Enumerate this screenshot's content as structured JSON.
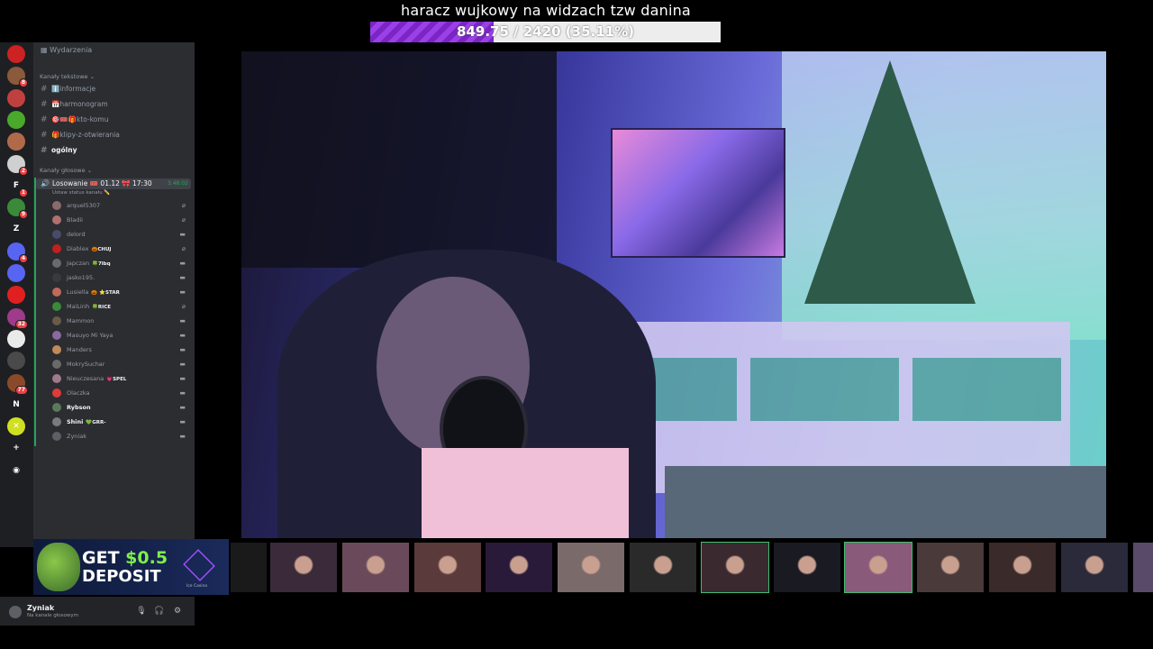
{
  "goal": {
    "title": "haracz wujkowy na widzach tzw danina",
    "progress_text": "849.75 / 2420 (35.11%)",
    "progress_fraction": 0.3511,
    "fill_color": "#8a2fd6"
  },
  "rail": {
    "servers": [
      {
        "icon": "server-icon",
        "letter": "",
        "color": "#c22",
        "badge": ""
      },
      {
        "icon": "server-icon",
        "letter": "",
        "color": "#8a5a3a",
        "badge": "8"
      },
      {
        "icon": "server-icon",
        "letter": "",
        "color": "#c04040",
        "badge": ""
      },
      {
        "icon": "server-icon",
        "letter": "",
        "color": "#4aa82a",
        "badge": ""
      },
      {
        "icon": "server-icon",
        "letter": "",
        "color": "#b06a4a",
        "badge": ""
      },
      {
        "icon": "server-icon",
        "letter": "",
        "color": "#d0d0d0",
        "badge": "2"
      },
      {
        "icon": "server-icon",
        "letter": "F",
        "color": "#1e1f22",
        "badge": "1"
      },
      {
        "icon": "server-icon",
        "letter": "",
        "color": "#3a8a3a",
        "badge": "9"
      },
      {
        "icon": "server-icon",
        "letter": "Z",
        "color": "#1e1f22",
        "badge": ""
      },
      {
        "icon": "server-icon",
        "letter": "",
        "color": "#5865f2",
        "badge": "4"
      },
      {
        "icon": "server-icon",
        "letter": "",
        "color": "#5865f2",
        "badge": ""
      },
      {
        "icon": "server-icon",
        "letter": "",
        "color": "#e02020",
        "badge": ""
      },
      {
        "icon": "server-icon",
        "letter": "",
        "color": "#a03a8a",
        "badge": "32"
      },
      {
        "icon": "server-icon",
        "letter": "",
        "color": "#eaeaea",
        "badge": ""
      },
      {
        "icon": "server-icon",
        "letter": "",
        "color": "#4a4a4a",
        "badge": ""
      },
      {
        "icon": "server-icon",
        "letter": "",
        "color": "#8a4a2a",
        "badge": "77"
      },
      {
        "icon": "server-icon",
        "letter": "N",
        "color": "#1e1f22",
        "badge": ""
      },
      {
        "icon": "server-icon",
        "letter": "✕",
        "color": "#d0e020",
        "badge": ""
      },
      {
        "icon": "add-server-icon",
        "letter": "+",
        "color": "#1e1f22",
        "badge": ""
      },
      {
        "icon": "explore-icon",
        "letter": "◉",
        "color": "#1e1f22",
        "badge": ""
      }
    ]
  },
  "channels": {
    "events_label": "Wydarzenia",
    "text_category": "Kanały tekstowe",
    "text_channels": [
      {
        "label": "ℹ️informacje"
      },
      {
        "label": "📅harmonogram"
      },
      {
        "label": "🎯🎟️🎁kto-komu"
      },
      {
        "label": "🎁klipy-z-otwierania"
      },
      {
        "label": "ogólny"
      }
    ],
    "voice_category": "Kanały głosowe",
    "voice_channel": {
      "name": "Losowanie 🎟️ 01.12 🎀 17:30",
      "timer": "3:48:02",
      "status": "Ustaw status kanału ✏️"
    },
    "members": [
      {
        "name": "arquel5307",
        "tag": "",
        "color": "#8a6a6a",
        "hi": false,
        "icon": "mic-muted-icon"
      },
      {
        "name": "Bladii",
        "tag": "",
        "color": "#b07070",
        "hi": false,
        "icon": "mic-muted-icon"
      },
      {
        "name": "delord",
        "tag": "",
        "color": "#4a4a6a",
        "hi": false,
        "icon": "video-icon"
      },
      {
        "name": "Diablex",
        "tag": "🎃CHUJ",
        "color": "#c02020",
        "hi": false,
        "icon": "mic-muted-icon"
      },
      {
        "name": "Japczan",
        "tag": "🍀7lbq",
        "color": "#6a6a6a",
        "hi": false,
        "icon": "video-icon"
      },
      {
        "name": "jasko195.",
        "tag": "",
        "color": "#3a3a3a",
        "hi": false,
        "icon": "video-icon"
      },
      {
        "name": "Lusiella",
        "tag": "🎃 ⭐STAR",
        "color": "#c06a5a",
        "hi": false,
        "icon": "video-icon"
      },
      {
        "name": "MaiLinh",
        "tag": "🍀RICE",
        "color": "#3a8a3a",
        "hi": false,
        "icon": "mic-muted-icon"
      },
      {
        "name": "Mammon",
        "tag": "",
        "color": "#6a5a4a",
        "hi": false,
        "icon": "video-icon"
      },
      {
        "name": "Masuyo Mi Yaya",
        "tag": "",
        "color": "#8a6aa0",
        "hi": false,
        "icon": "video-icon"
      },
      {
        "name": "Manders",
        "tag": "",
        "color": "#c08a5a",
        "hi": false,
        "icon": "video-icon"
      },
      {
        "name": "MokrySuchar",
        "tag": "",
        "color": "#6a6a6a",
        "hi": false,
        "icon": "video-icon"
      },
      {
        "name": "Nieuczesana",
        "tag": "💗SPEL",
        "color": "#a07a8a",
        "hi": false,
        "icon": "video-icon"
      },
      {
        "name": "Olaczka",
        "tag": "",
        "color": "#e03a3a",
        "hi": false,
        "icon": "video-icon"
      },
      {
        "name": "Rybson",
        "tag": "",
        "color": "#5a7a5a",
        "hi": true,
        "icon": "video-icon"
      },
      {
        "name": "Shini",
        "tag": "💚GRR-",
        "color": "#7a7a7a",
        "hi": true,
        "icon": "video-icon"
      },
      {
        "name": "Zyniak",
        "tag": "",
        "color": "#5c5f66",
        "hi": false,
        "icon": "video-icon"
      }
    ]
  },
  "user_panel": {
    "name": "Zyniak",
    "status": "Na kanale głosowym"
  },
  "ad": {
    "line1": "GET ",
    "line1_accent": "$0.5",
    "line2": "DEPOSIT",
    "logo_label": "Ice Casino"
  },
  "thumbnails": [
    {
      "color": "#3a2a3a",
      "selected": false
    },
    {
      "color": "#6a4a5a",
      "selected": false
    },
    {
      "color": "#5a3a3a",
      "selected": false
    },
    {
      "color": "#2a1a3a",
      "selected": false
    },
    {
      "color": "#7a6a6a",
      "selected": false
    },
    {
      "color": "#2a2a2a",
      "selected": false
    },
    {
      "color": "#3a2a30",
      "selected": true
    },
    {
      "color": "#1a1a22",
      "selected": false
    },
    {
      "color": "#8a5a7a",
      "selected": true
    },
    {
      "color": "#4a3a3a",
      "selected": false
    },
    {
      "color": "#3a2a2a",
      "selected": false
    },
    {
      "color": "#2a2a3a",
      "selected": false
    },
    {
      "color": "#5a4a6a",
      "selected": false
    }
  ]
}
